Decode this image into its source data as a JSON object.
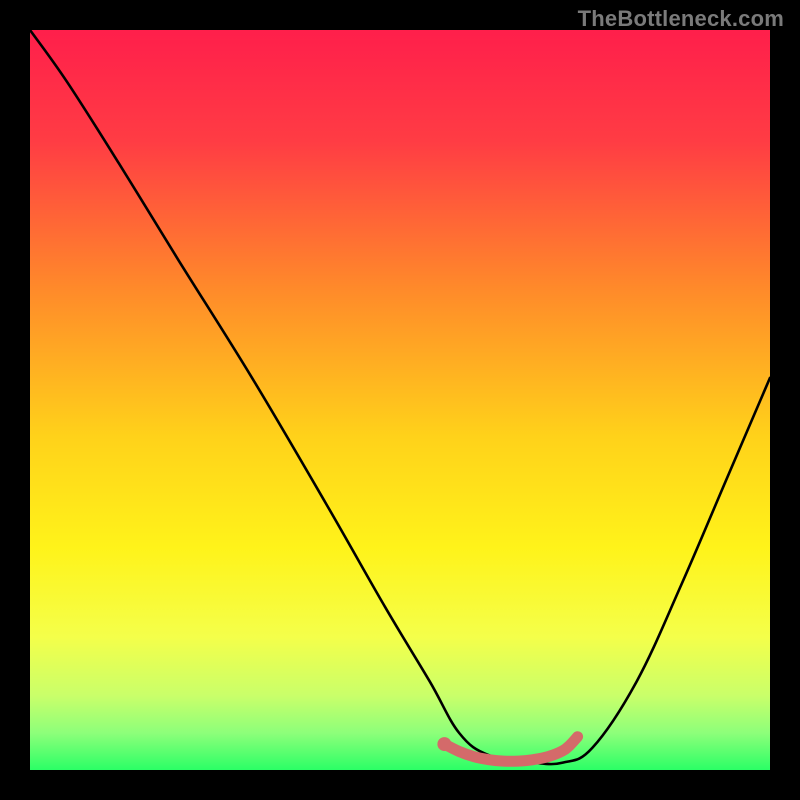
{
  "attribution": "TheBottleneck.com",
  "chart_data": {
    "type": "line",
    "title": "",
    "xlabel": "",
    "ylabel": "",
    "xlim": [
      0,
      100
    ],
    "ylim": [
      0,
      100
    ],
    "gradient_stops": [
      {
        "offset": 0.0,
        "color": "#ff1f4b"
      },
      {
        "offset": 0.15,
        "color": "#ff3c44"
      },
      {
        "offset": 0.35,
        "color": "#ff8a2a"
      },
      {
        "offset": 0.55,
        "color": "#ffd21a"
      },
      {
        "offset": 0.7,
        "color": "#fff31a"
      },
      {
        "offset": 0.82,
        "color": "#f4ff4a"
      },
      {
        "offset": 0.9,
        "color": "#c9ff6a"
      },
      {
        "offset": 0.95,
        "color": "#8dff7a"
      },
      {
        "offset": 1.0,
        "color": "#2bff66"
      }
    ],
    "series": [
      {
        "name": "bottleneck-curve",
        "color": "#000000",
        "x": [
          0,
          5,
          12,
          20,
          30,
          40,
          48,
          54,
          58,
          62,
          68,
          72,
          76,
          82,
          88,
          94,
          100
        ],
        "y": [
          100,
          93,
          82,
          69,
          53,
          36,
          22,
          12,
          5,
          2,
          1,
          1,
          3,
          12,
          25,
          39,
          53
        ]
      }
    ],
    "highlight": {
      "name": "optimal-range",
      "color": "#d46a6a",
      "x": [
        56,
        58,
        60,
        62,
        64,
        66,
        68,
        70,
        72,
        73,
        74
      ],
      "y": [
        3.5,
        2.5,
        1.8,
        1.4,
        1.2,
        1.2,
        1.4,
        1.8,
        2.6,
        3.4,
        4.5
      ],
      "endpoint": {
        "x": 56,
        "y": 3.5
      }
    }
  }
}
